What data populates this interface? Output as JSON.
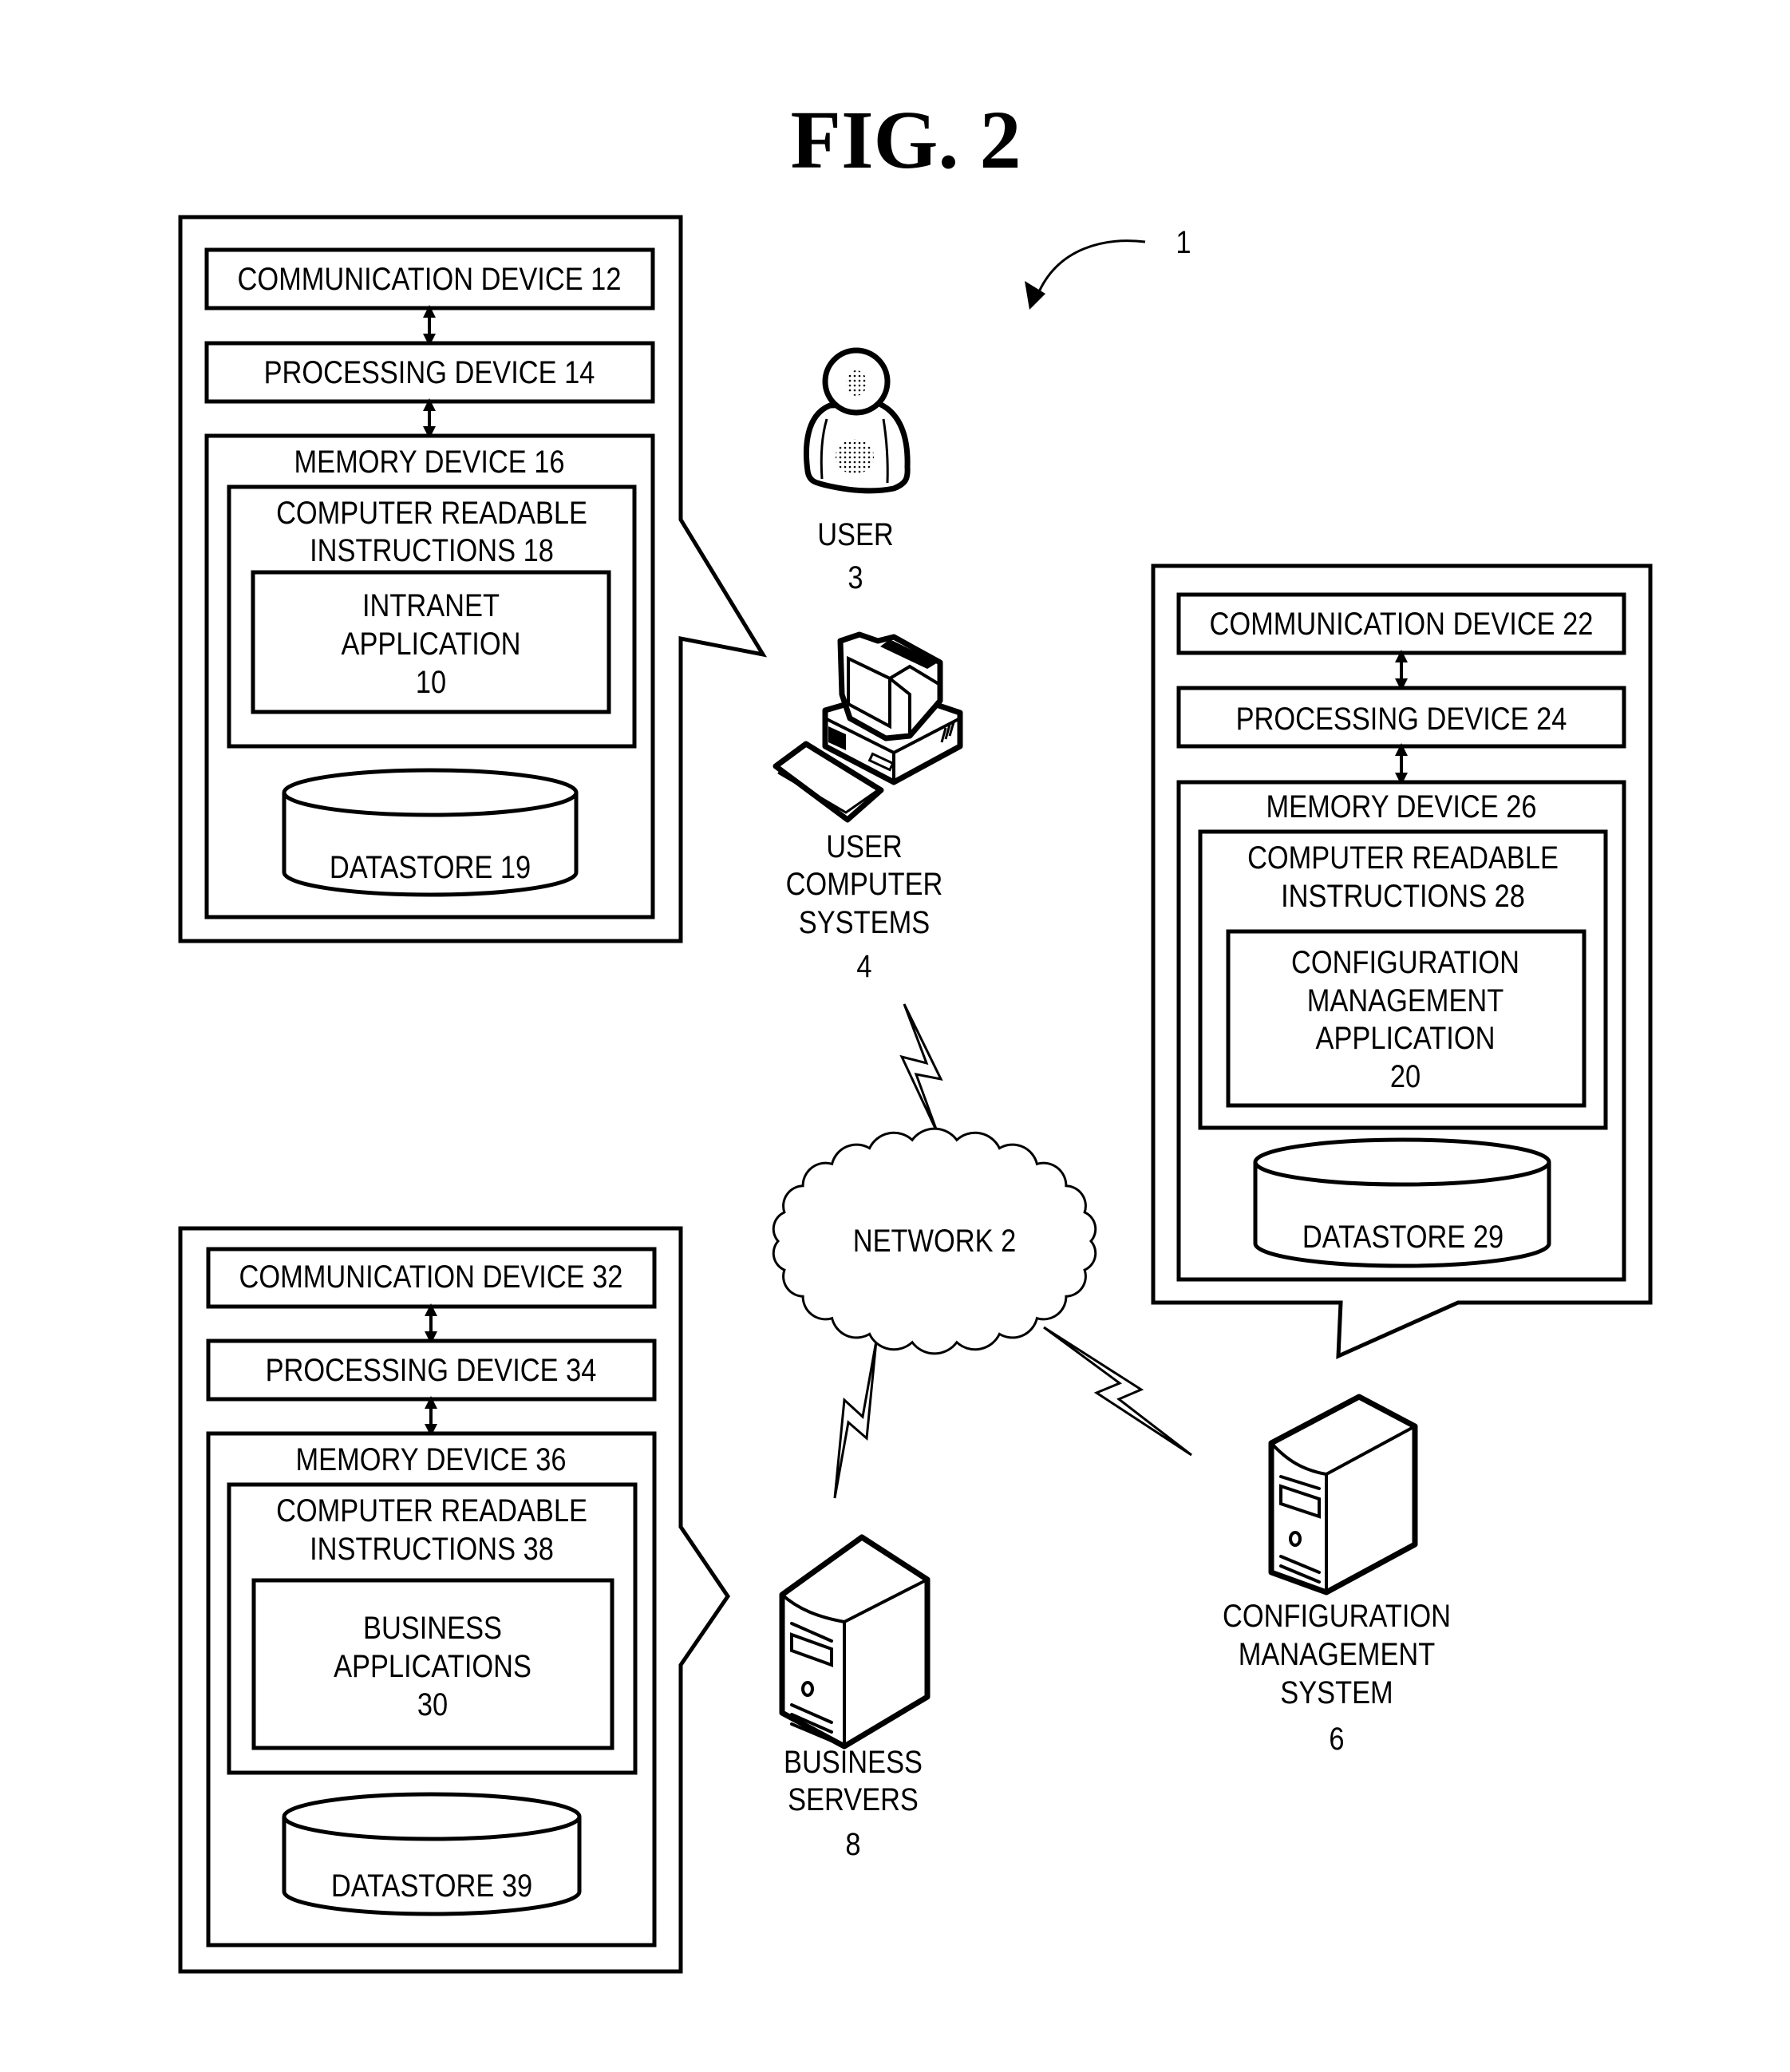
{
  "figure": {
    "title": "FIG. 2",
    "system_ref": "1"
  },
  "intranet_system": {
    "communication_device": "COMMUNICATION DEVICE 12",
    "processing_device": "PROCESSING DEVICE 14",
    "memory_device": "MEMORY DEVICE 16",
    "instructions": [
      "COMPUTER READABLE",
      "INSTRUCTIONS 18"
    ],
    "application": [
      "INTRANET",
      "APPLICATION",
      "10"
    ],
    "datastore": "DATASTORE 19"
  },
  "config_system": {
    "communication_device": "COMMUNICATION DEVICE 22",
    "processing_device": "PROCESSING DEVICE 24",
    "memory_device": "MEMORY DEVICE 26",
    "instructions": [
      "COMPUTER READABLE",
      "INSTRUCTIONS 28"
    ],
    "application": [
      "CONFIGURATION",
      "MANAGEMENT",
      "APPLICATION",
      "20"
    ],
    "datastore": "DATASTORE 29"
  },
  "business_system": {
    "communication_device": "COMMUNICATION DEVICE 32",
    "processing_device": "PROCESSING DEVICE 34",
    "memory_device": "MEMORY DEVICE 36",
    "instructions": [
      "COMPUTER READABLE",
      "INSTRUCTIONS 38"
    ],
    "application": [
      "BUSINESS",
      "APPLICATIONS",
      "30"
    ],
    "datastore": "DATASTORE 39"
  },
  "nodes": {
    "user": [
      "USER",
      "3"
    ],
    "user_computer_systems": [
      "USER",
      "COMPUTER",
      "SYSTEMS",
      "4"
    ],
    "network": "NETWORK 2",
    "business_servers": [
      "BUSINESS",
      "SERVERS",
      "8"
    ],
    "configuration_management_system": [
      "CONFIGURATION",
      "MANAGEMENT",
      "SYSTEM",
      "6"
    ]
  },
  "icons": {
    "user": "user-person-icon",
    "user_computer": "desktop-computer-icon",
    "network": "cloud-icon",
    "server": "tower-server-icon",
    "datastore": "database-cylinder-icon",
    "wireless_link": "lightning-bolt-icon"
  }
}
